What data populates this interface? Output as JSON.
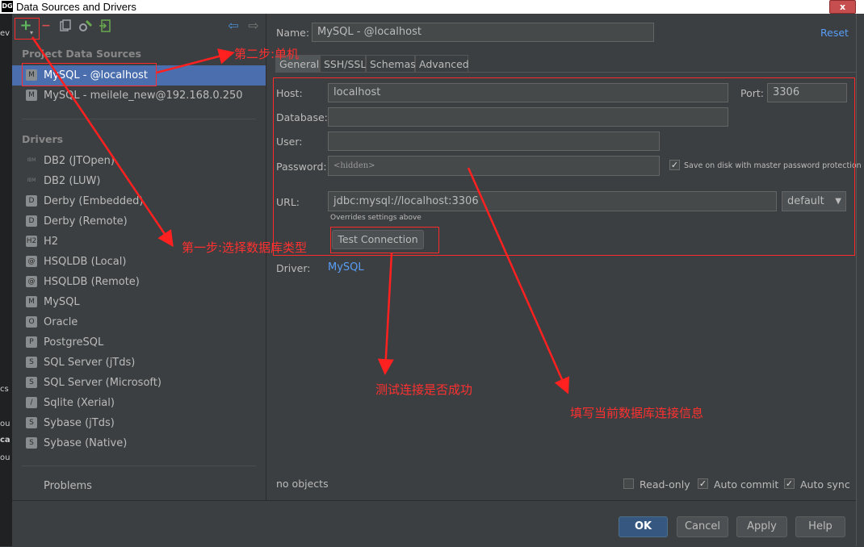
{
  "window": {
    "title": "Data Sources and Drivers",
    "close": "x"
  },
  "toolbar": {
    "add": "+",
    "remove": "−",
    "back": "⇦",
    "forward": "⇨"
  },
  "left": {
    "project_header": "Project Data Sources",
    "sources": [
      {
        "label": "MySQL - @localhost"
      },
      {
        "label": "MySQL - meilele_new@192.168.0.250"
      }
    ],
    "drivers_header": "Drivers",
    "drivers": [
      {
        "label": "DB2 (JTOpen)",
        "icon": "IBM"
      },
      {
        "label": "DB2 (LUW)",
        "icon": "IBM"
      },
      {
        "label": "Derby (Embedded)",
        "icon": "D"
      },
      {
        "label": "Derby (Remote)",
        "icon": "D"
      },
      {
        "label": "H2",
        "icon": "H2"
      },
      {
        "label": "HSQLDB (Local)",
        "icon": "@"
      },
      {
        "label": "HSQLDB (Remote)",
        "icon": "@"
      },
      {
        "label": "MySQL",
        "icon": "M"
      },
      {
        "label": "Oracle",
        "icon": "O"
      },
      {
        "label": "PostgreSQL",
        "icon": "P"
      },
      {
        "label": "SQL Server (jTds)",
        "icon": "S"
      },
      {
        "label": "SQL Server (Microsoft)",
        "icon": "S"
      },
      {
        "label": "Sqlite (Xerial)",
        "icon": "/"
      },
      {
        "label": "Sybase (jTds)",
        "icon": "S"
      },
      {
        "label": "Sybase (Native)",
        "icon": "S"
      }
    ],
    "problems": "Problems"
  },
  "right": {
    "name_label": "Name:",
    "name_value": "MySQL - @localhost",
    "reset": "Reset",
    "tabs": [
      "General",
      "SSH/SSL",
      "Schemas",
      "Advanced"
    ],
    "host_label": "Host:",
    "host_value": "localhost",
    "port_label": "Port:",
    "port_value": "3306",
    "database_label": "Database:",
    "database_value": "",
    "user_label": "User:",
    "user_value": "",
    "password_label": "Password:",
    "password_value": "<hidden>",
    "save_on_disk": "Save on disk with master password protection",
    "url_label": "URL:",
    "url_value": "jdbc:mysql://localhost:3306",
    "url_mode": "default",
    "overrides": "Overrides settings above",
    "test_connection": "Test Connection",
    "driver_label": "Driver:",
    "driver_value": "MySQL",
    "no_objects": "no objects",
    "read_only": "Read-only",
    "auto_commit": "Auto commit",
    "auto_sync": "Auto sync"
  },
  "buttons": {
    "ok": "OK",
    "cancel": "Cancel",
    "apply": "Apply",
    "help": "Help"
  },
  "annotations": {
    "step2": "第二步:单机",
    "step1": "第一步:选择数据库类型",
    "test": "测试连接是否成功",
    "fill": "填写当前数据库连接信息"
  },
  "colors": {
    "accent": "#4b6eaf",
    "annotation": "#ff3030",
    "link": "#589df6"
  },
  "left_strip_text": [
    "ev",
    "cs",
    "ou",
    "ca",
    "ou"
  ]
}
